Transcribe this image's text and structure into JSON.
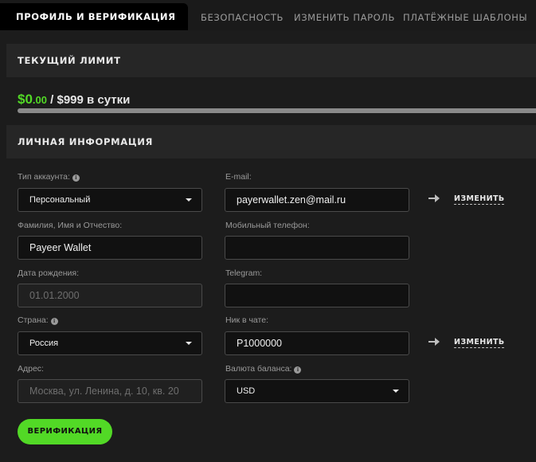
{
  "tabs": [
    {
      "label": "Профиль и верификация",
      "active": true
    },
    {
      "label": "Безопасность"
    },
    {
      "label": "Изменить пароль"
    },
    {
      "label": "Платёжные шаблоны"
    }
  ],
  "limit_section": {
    "title": "Текущий лимит",
    "current_int": "$0",
    "current_dec": ".00",
    "max_text": " / $999 в сутки",
    "progress_fraction": 0.0
  },
  "personal_section": {
    "title": "Личная информация"
  },
  "form": {
    "account_type": {
      "label": "Тип аккаунта:",
      "value": "Персональный"
    },
    "full_name": {
      "label": "Фамилия, Имя и Отчество:",
      "value": "Payeer Wallet"
    },
    "birth_date": {
      "label": "Дата рождения:",
      "value": "01.01.2000"
    },
    "country": {
      "label": "Страна:",
      "value": "Россия"
    },
    "address": {
      "label": "Адрес:",
      "placeholder": "Москва, ул. Ленина, д. 10, кв. 20"
    },
    "email": {
      "label": "E-mail:",
      "value": "payerwallet.zen@mail.ru",
      "change_label": "Изменить"
    },
    "phone": {
      "label": "Мобильный телефон:",
      "value": ""
    },
    "telegram": {
      "label": "Telegram:",
      "value": ""
    },
    "chat_nick": {
      "label": "Ник в чате:",
      "value": "P1000000",
      "change_label": "Изменить"
    },
    "balance_currency": {
      "label": "Валюта баланса:",
      "value": "USD"
    }
  },
  "verify_button": "Верификация",
  "colors": {
    "accent": "#52d926",
    "background": "#1c1c1c",
    "tab_active": "#000000"
  }
}
